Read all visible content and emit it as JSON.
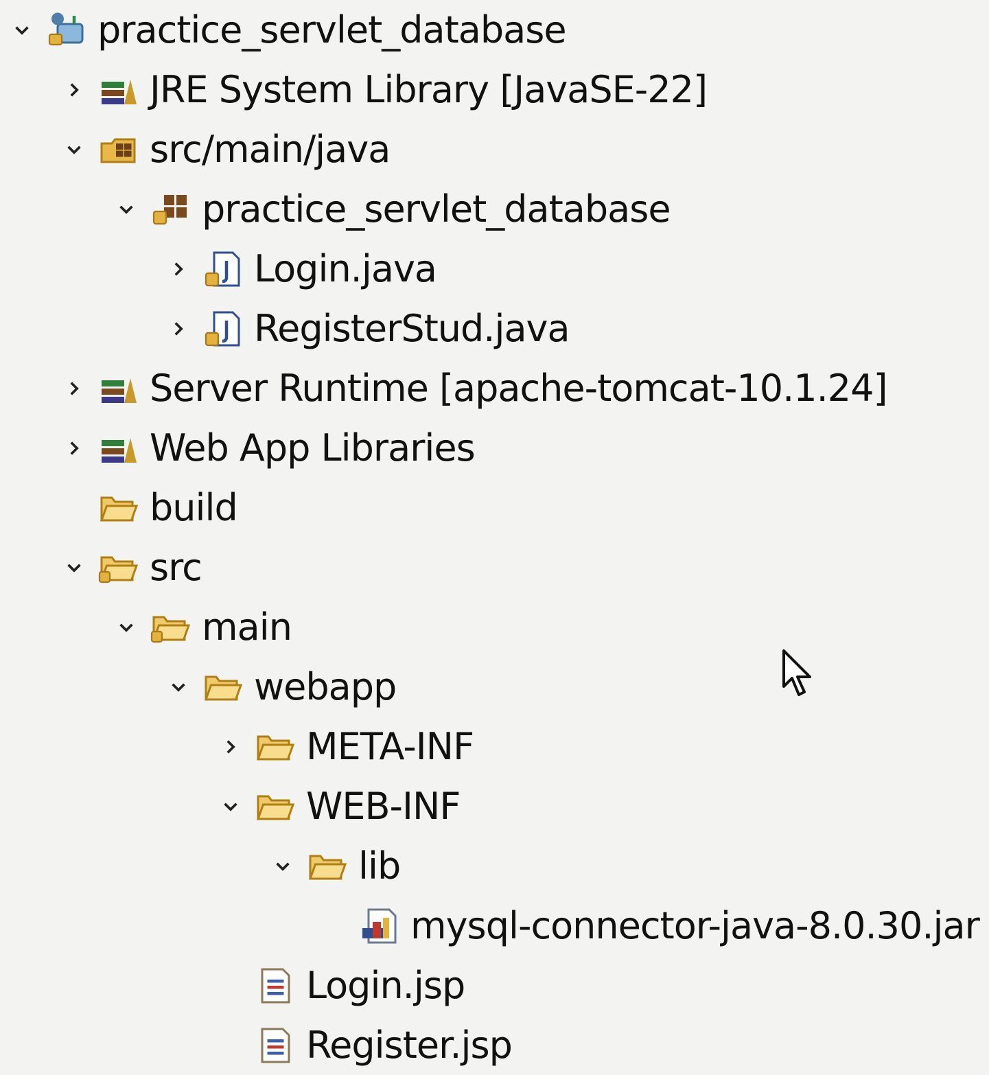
{
  "project_explorer": {
    "items": [
      {
        "label": "practice_servlet_database",
        "depth": 0,
        "expanded": true,
        "has_children": true,
        "icon": "project-icon"
      },
      {
        "label": "JRE System Library [JavaSE-22]",
        "depth": 1,
        "expanded": false,
        "has_children": true,
        "icon": "library-icon"
      },
      {
        "label": "src/main/java",
        "depth": 1,
        "expanded": true,
        "has_children": true,
        "icon": "source-folder-icon"
      },
      {
        "label": "practice_servlet_database",
        "depth": 2,
        "expanded": true,
        "has_children": true,
        "icon": "package-icon"
      },
      {
        "label": "Login.java",
        "depth": 3,
        "expanded": false,
        "has_children": true,
        "icon": "java-file-icon"
      },
      {
        "label": "RegisterStud.java",
        "depth": 3,
        "expanded": false,
        "has_children": true,
        "icon": "java-file-icon"
      },
      {
        "label": "Server Runtime [apache-tomcat-10.1.24]",
        "depth": 1,
        "expanded": false,
        "has_children": true,
        "icon": "library-icon"
      },
      {
        "label": "Web App Libraries",
        "depth": 1,
        "expanded": false,
        "has_children": true,
        "icon": "library-icon"
      },
      {
        "label": "build",
        "depth": 1,
        "expanded": false,
        "has_children": false,
        "icon": "folder-icon"
      },
      {
        "label": "src",
        "depth": 1,
        "expanded": true,
        "has_children": true,
        "icon": "folder-icon"
      },
      {
        "label": "main",
        "depth": 2,
        "expanded": true,
        "has_children": true,
        "icon": "folder-icon"
      },
      {
        "label": "webapp",
        "depth": 3,
        "expanded": true,
        "has_children": true,
        "icon": "folder-icon"
      },
      {
        "label": "META-INF",
        "depth": 4,
        "expanded": false,
        "has_children": true,
        "icon": "folder-icon"
      },
      {
        "label": "WEB-INF",
        "depth": 4,
        "expanded": true,
        "has_children": true,
        "icon": "folder-icon"
      },
      {
        "label": "lib",
        "depth": 5,
        "expanded": true,
        "has_children": true,
        "icon": "folder-icon"
      },
      {
        "label": "mysql-connector-java-8.0.30.jar",
        "depth": 6,
        "expanded": false,
        "has_children": false,
        "icon": "jar-file-icon"
      },
      {
        "label": "Login.jsp",
        "depth": 4,
        "expanded": false,
        "has_children": false,
        "icon": "jsp-file-icon"
      },
      {
        "label": "Register.jsp",
        "depth": 4,
        "expanded": false,
        "has_children": false,
        "icon": "jsp-file-icon"
      }
    ]
  },
  "colors": {
    "background": "#f3f3f1",
    "text": "#111111",
    "folder": "#e8b84a",
    "folder_outline": "#b07f14",
    "library_green": "#2f7f3a",
    "library_brown": "#7a4a1e",
    "java_blue": "#2f4f8f"
  }
}
